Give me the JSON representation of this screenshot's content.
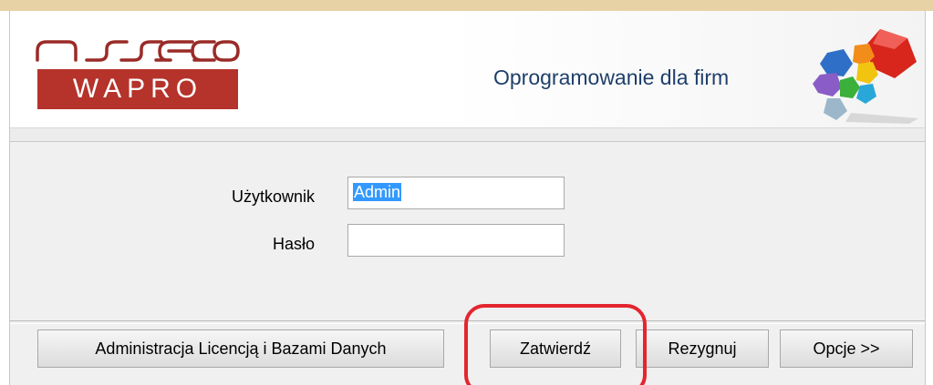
{
  "window": {
    "brand_top": "asseco",
    "brand_bottom": "WAPRO",
    "tagline": "Oprogramowanie dla firm",
    "logo_icon": "colored-cubes-logo-icon"
  },
  "form": {
    "user_label": "Użytkownik",
    "user_value": "Admin",
    "password_label": "Hasło",
    "password_value": ""
  },
  "buttons": {
    "admin_label": "Administracja Licencją i Bazami Danych",
    "confirm_label": "Zatwierdź",
    "cancel_label": "Rezygnuj",
    "options_label": "Opcje >>"
  },
  "colors": {
    "brand_red": "#b5332b",
    "tagline_blue": "#1f3f6a",
    "annotation_red": "#e4252f",
    "selection_blue": "#3399ff"
  }
}
